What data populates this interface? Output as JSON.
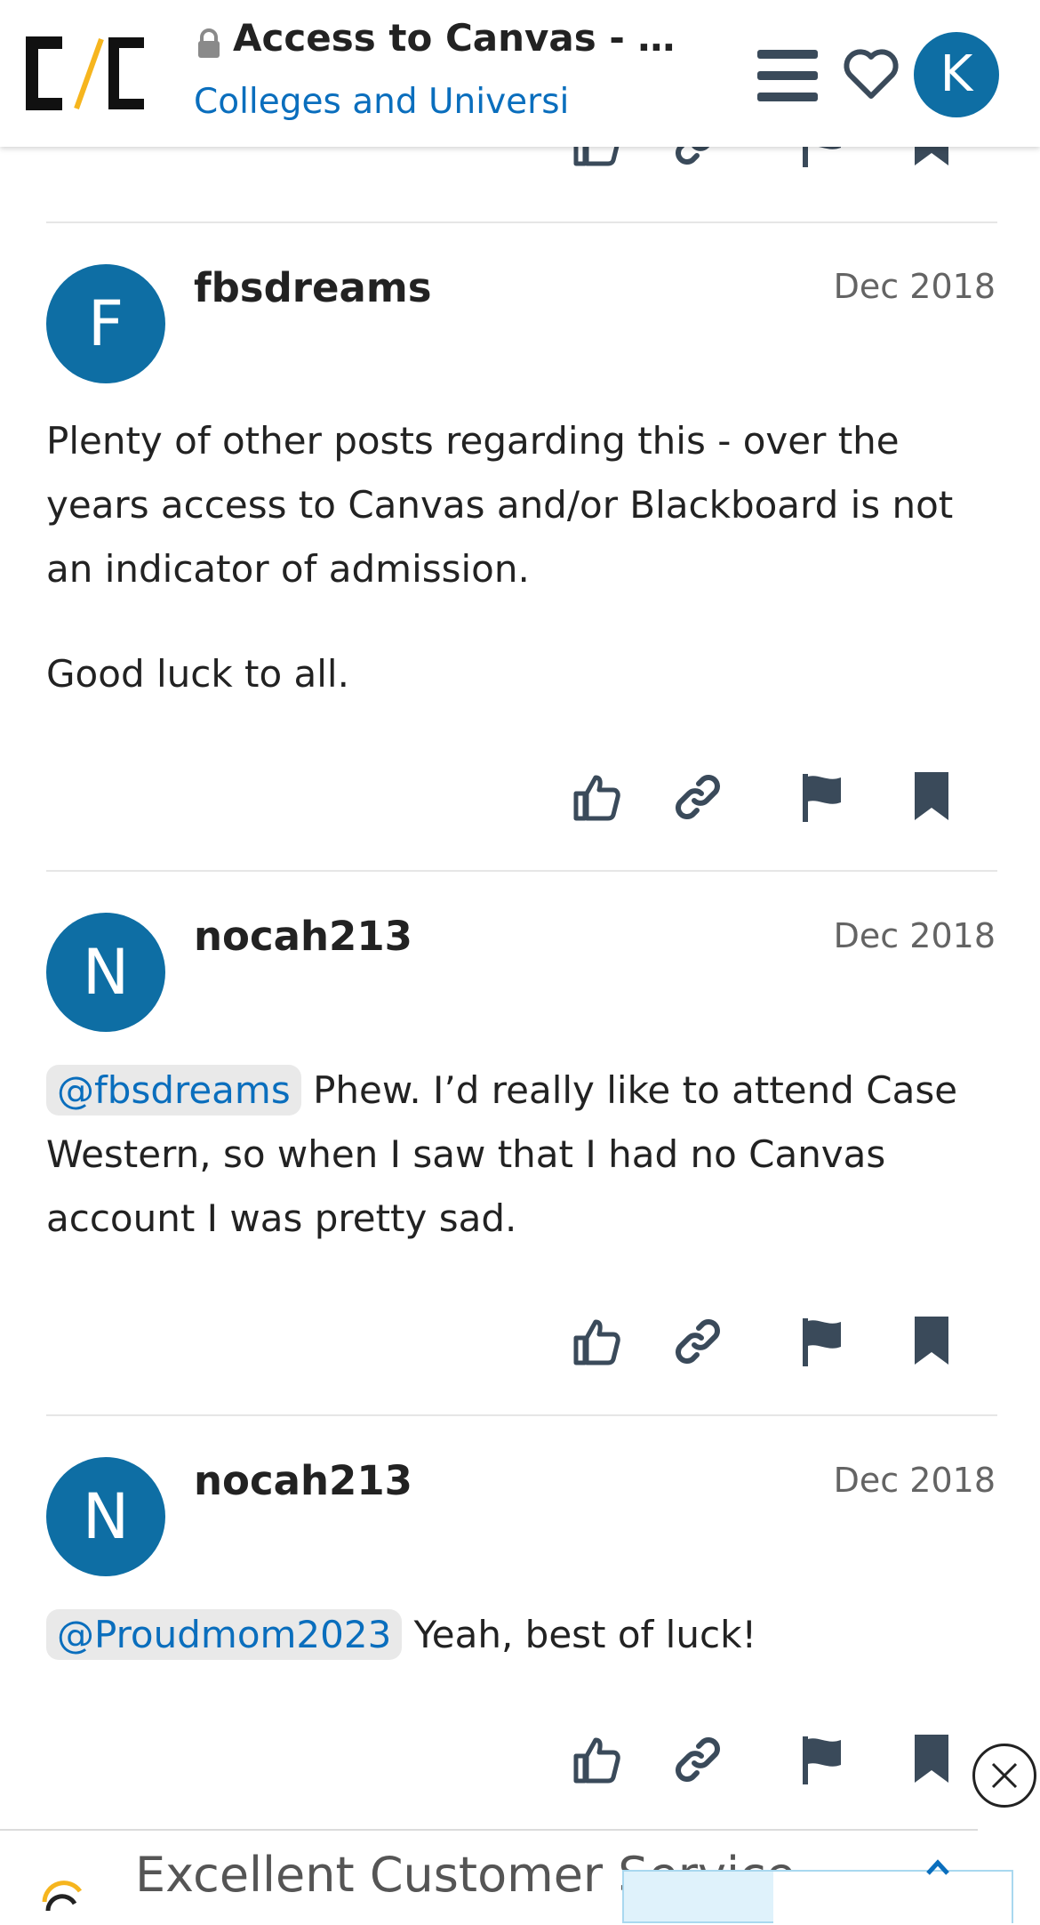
{
  "header": {
    "logo_alt": "C/C",
    "title": "Access to Canvas - …",
    "category": "Colleges and Universi",
    "avatar_letter": "K"
  },
  "posts": [
    {
      "avatar_letter": "F",
      "username": "fbsdreams",
      "date": "Dec 2018",
      "paragraphs": [
        "Plenty of other posts regarding this - over the years access to Canvas and/or Blackboard is not an indicator of admission.",
        "Good luck to all."
      ]
    },
    {
      "avatar_letter": "N",
      "username": "nocah213",
      "date": "Dec 2018",
      "mention": "@fbsdreams",
      "text": " Phew. I’d really like to attend Case Western, so when I saw that I had no Canvas account I was pretty sad."
    },
    {
      "avatar_letter": "N",
      "username": "nocah213",
      "date": "Dec 2018",
      "mention": "@Proudmom2023",
      "text": " Yeah, best of luck!"
    }
  ],
  "post_actions": [
    "like-icon",
    "link-icon",
    "flag-icon",
    "bookmark-icon"
  ],
  "ad": {
    "text": "Excellent Customer Service"
  },
  "colors": {
    "accent_blue": "#0e6ea4",
    "link_blue": "#0a6ebd",
    "icon_gray": "#3a4a5a",
    "logo_yellow": "#f6b51e"
  }
}
